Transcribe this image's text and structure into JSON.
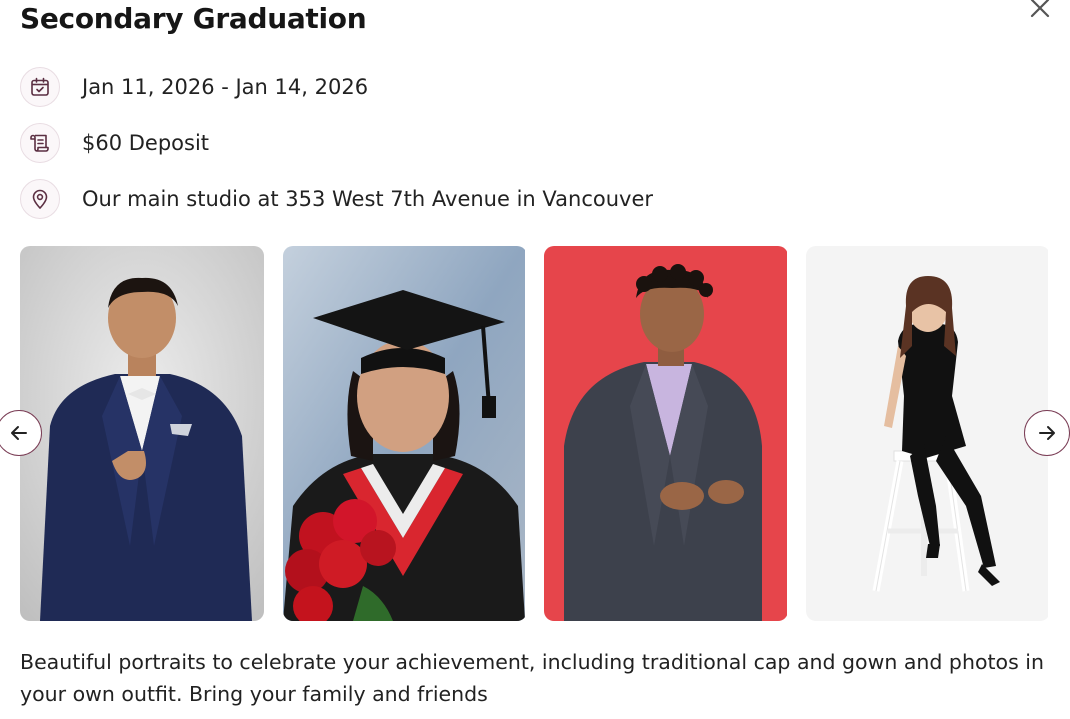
{
  "modal": {
    "title": "Secondary Graduation",
    "close_icon": "close-icon"
  },
  "details": [
    {
      "icon": "calendar-icon",
      "text": "Jan 11, 2026 - Jan 14, 2026"
    },
    {
      "icon": "receipt-icon",
      "text": "$60 Deposit"
    },
    {
      "icon": "location-pin-icon",
      "text": "Our main studio at 353 West 7th Avenue in Vancouver"
    }
  ],
  "gallery": {
    "prev_icon": "arrow-left-icon",
    "next_icon": "arrow-right-icon",
    "photos": [
      {
        "subject": "young man in navy suit and bow tie",
        "background": "#d7d7d7"
      },
      {
        "subject": "graduate in cap and gown holding red roses",
        "background": "#9fb3c9"
      },
      {
        "subject": "young man in grey suit on red background",
        "background": "#e84148"
      },
      {
        "subject": "young woman in black outfit seated on white stool",
        "background": "#f4f4f4"
      }
    ]
  },
  "description": "Beautiful portraits to celebrate your achievement, including traditional cap and gown and photos in your own outfit. Bring your family and friends",
  "colors": {
    "accent": "#7a3d55",
    "icon_bg": "#fbf7f9",
    "text": "#222222"
  }
}
